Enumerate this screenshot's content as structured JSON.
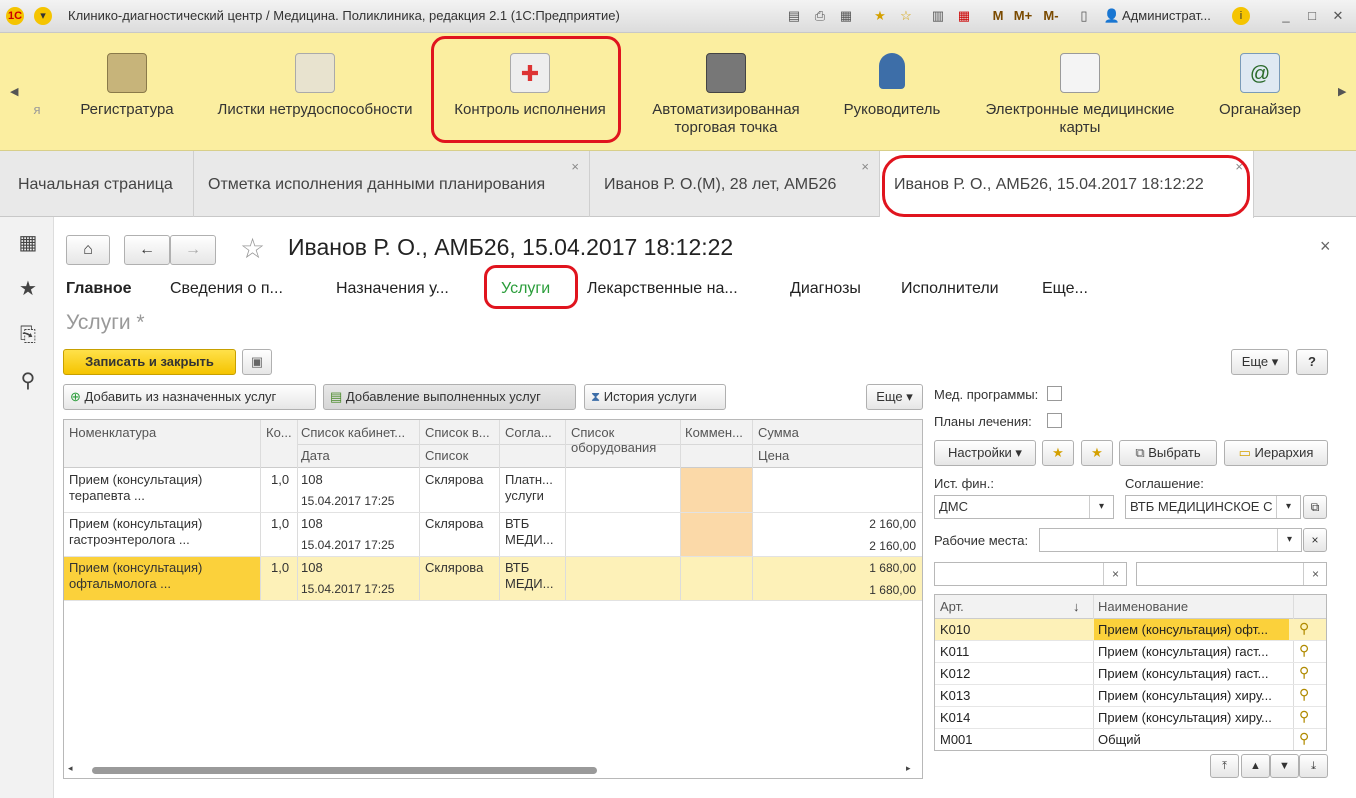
{
  "window": {
    "title": "Клинико-диагностический центр / Медицина. Поликлиника, редакция 2.1  (1С:Предприятие)",
    "user": "Администрат...",
    "mem_buttons": [
      "M",
      "M+",
      "M-"
    ]
  },
  "sections": [
    {
      "label": "я"
    },
    {
      "label": "Регистратура"
    },
    {
      "label": "Листки нетрудоспособности"
    },
    {
      "label": "Контроль исполнения"
    },
    {
      "label": "Автоматизированная торговая точка"
    },
    {
      "label": "Руководитель"
    },
    {
      "label": "Электронные медицинские карты"
    },
    {
      "label": "Органайзер"
    }
  ],
  "open_tabs": [
    {
      "label": "Начальная страница"
    },
    {
      "label": "Отметка исполнения данными планирования",
      "close": "×"
    },
    {
      "label": "Иванов Р. О.(М), 28 лет, АМБ26",
      "close": "×"
    },
    {
      "label": "Иванов Р. О., АМБ26, 15.04.2017 18:12:22",
      "close": "×"
    }
  ],
  "form": {
    "title": "Иванов Р. О., АМБ26, 15.04.2017 18:12:22",
    "close": "×",
    "tabs": [
      "Главное",
      "Сведения о п...",
      "Назначения у...",
      "Услуги",
      "Лекарственные на...",
      "Диагнозы",
      "Исполнители",
      "Еще..."
    ],
    "subtitle": "Услуги *",
    "save_close": "Записать и закрыть",
    "more": "Еще",
    "help": "?"
  },
  "services_toolbar": {
    "add_assigned": "Добавить из назначенных услуг",
    "add_done": "Добавление выполненных услуг",
    "history": "История услуги",
    "more": "Еще"
  },
  "grid": {
    "headers_top": [
      "Номенклатура",
      "Ко...",
      "Список кабинет...",
      "Список в...",
      "Согла...",
      "Список оборудования",
      "Коммен...",
      "Сумма"
    ],
    "headers_bottom": [
      "Дата",
      "Список",
      "Цена"
    ],
    "rows": [
      {
        "name": "Прием (консультация) терапевта ...",
        "qty": "1,0",
        "cabinet": "108",
        "date": "15.04.2017 17:25",
        "list": "Склярова",
        "agreement": "Платн... услуги",
        "sum": "",
        "price": ""
      },
      {
        "name": "Прием (консультация) гастроэнтеролога ...",
        "qty": "1,0",
        "cabinet": "108",
        "date": "15.04.2017 17:25",
        "list": "Склярова",
        "agreement": "ВТБ МЕДИ...",
        "sum": "2 160,00",
        "price": "2 160,00"
      },
      {
        "name": "Прием (консультация) офтальмолога ...",
        "qty": "1,0",
        "cabinet": "108",
        "date": "15.04.2017 17:25",
        "list": "Склярова",
        "agreement": "ВТБ МЕДИ...",
        "sum": "1 680,00",
        "price": "1 680,00"
      }
    ]
  },
  "right_panel": {
    "med_programs": "Мед. программы:",
    "treatment_plans": "Планы лечения:",
    "settings": "Настройки",
    "select": "Выбрать",
    "hierarchy": "Иерархия",
    "fin_source_label": "Ист. фин.:",
    "fin_source_value": "ДМС",
    "agreement_label": "Соглашение:",
    "agreement_value": "ВТБ МЕДИЦИНСКОЕ С",
    "workplaces_label": "Рабочие места:",
    "col_art": "Арт.",
    "col_name": "Наименование",
    "items": [
      {
        "art": "K010",
        "name": "Прием (консультация) офт..."
      },
      {
        "art": "K011",
        "name": "Прием (консультация) гаст..."
      },
      {
        "art": "K012",
        "name": "Прием (консультация) гаст..."
      },
      {
        "art": "K013",
        "name": "Прием (консультация) хиру..."
      },
      {
        "art": "K014",
        "name": "Прием (консультация) хиру..."
      },
      {
        "art": "M001",
        "name": "Общий"
      }
    ]
  },
  "colors": {
    "sections_bg": "#fbeea0",
    "highlight_row": "#fdf1b8",
    "selected_cell": "#fbd13b",
    "accent_green": "#2a9d3a",
    "annotation_red": "#e0141e",
    "comment_cell": "#fbd9a8"
  }
}
